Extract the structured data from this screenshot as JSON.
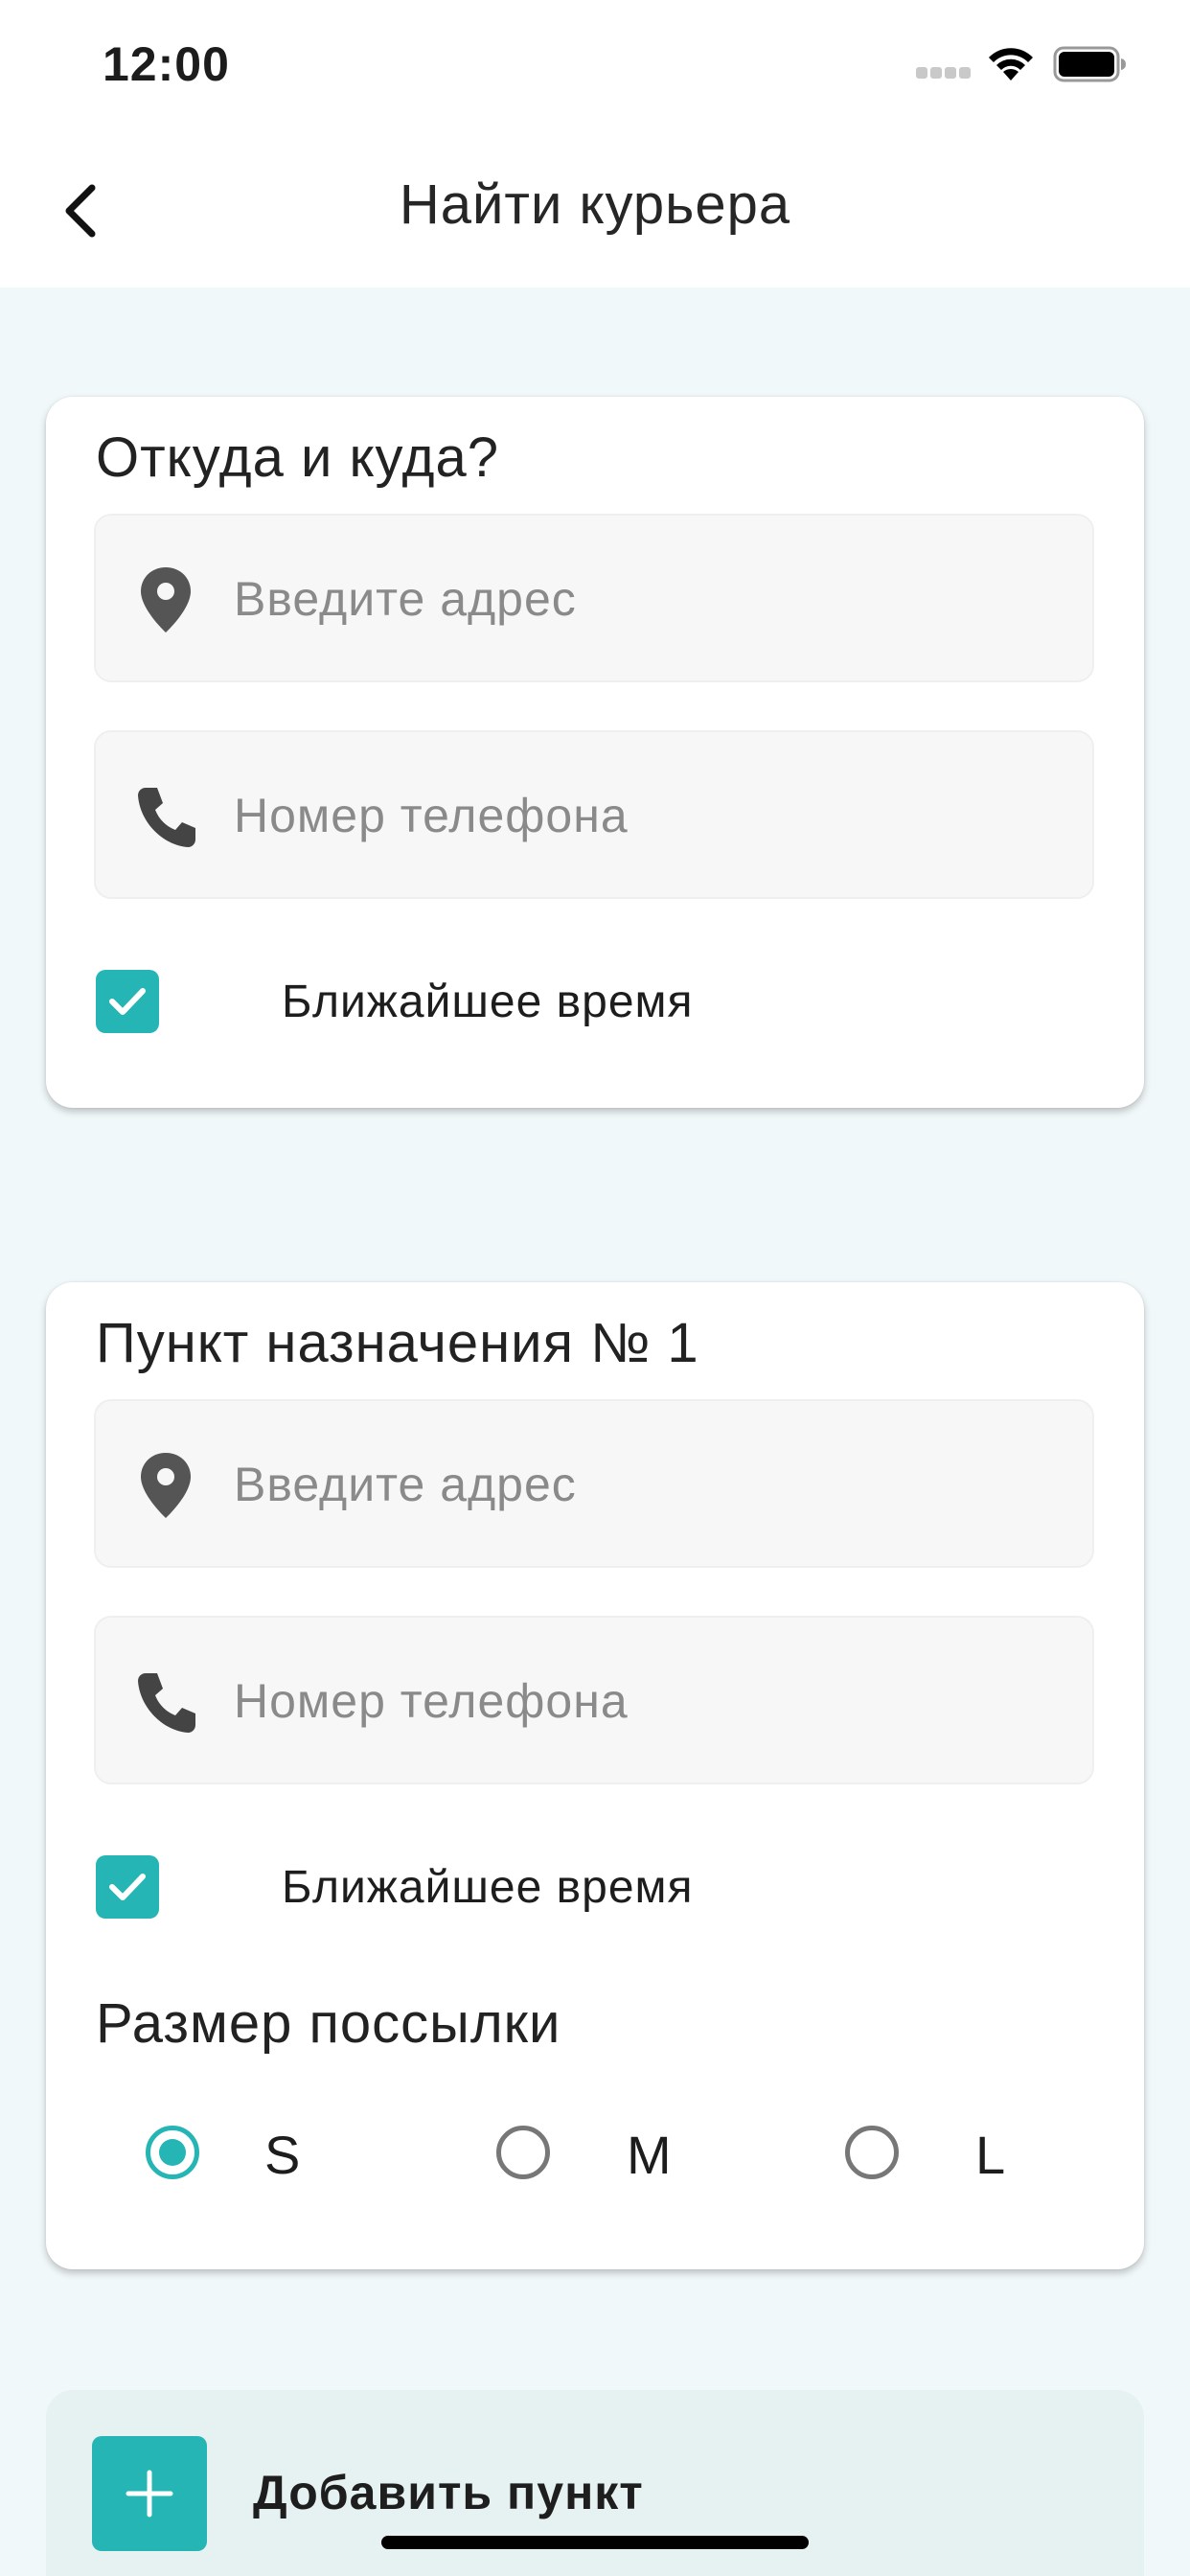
{
  "status_bar": {
    "time": "12:00"
  },
  "header": {
    "title": "Найти курьера"
  },
  "colors": {
    "accent": "#26b5b5",
    "background": "#f1f8f9",
    "field_bg": "#f7f7f7",
    "add_block_bg": "#e6f2f2"
  },
  "origin_card": {
    "title": "Откуда и куда?",
    "address_placeholder": "Введите адрес",
    "phone_placeholder": "Номер телефона",
    "nearest_time_label": "Ближайшее время",
    "nearest_time_checked": true
  },
  "destination_card": {
    "title": "Пункт назначения № 1",
    "address_placeholder": "Введите адрес",
    "phone_placeholder": "Номер телефона",
    "nearest_time_label": "Ближайшее время",
    "nearest_time_checked": true,
    "parcel_size_heading": "Размер поссылки",
    "sizes": [
      {
        "label": "S",
        "selected": true
      },
      {
        "label": "M",
        "selected": false
      },
      {
        "label": "L",
        "selected": false
      }
    ]
  },
  "add_point": {
    "label": "Добавить пункт"
  },
  "icons": {
    "back": "chevron-left-icon",
    "location": "location-pin-icon",
    "phone": "phone-icon",
    "check": "check-icon",
    "plus": "plus-icon",
    "wifi": "wifi-icon",
    "battery": "battery-icon",
    "signal": "signal-icon"
  }
}
